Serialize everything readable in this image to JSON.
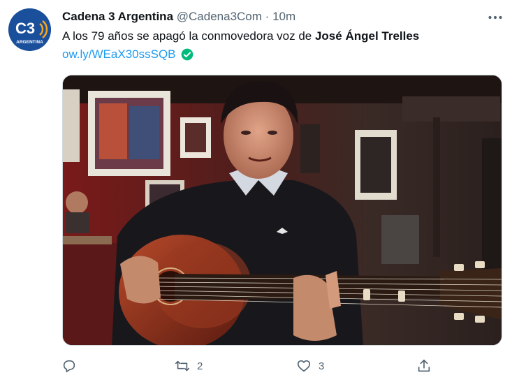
{
  "tweet": {
    "author_name": "Cadena 3 Argentina",
    "handle": "@Cadena3Com",
    "separator": "·",
    "time": "10m",
    "text_prefix": "A los 79 años se apagó la conmovedora voz de ",
    "text_bold": "José Ángel Trelles",
    "link": "ow.ly/WEaX30ssSQB",
    "link_badge_icon": "verified-check-icon",
    "avatar": {
      "logo_text": "C3",
      "logo_subtext": "ARGENTINA",
      "bg_color": "#1a4f9c",
      "accent_color": "#f5a623"
    },
    "media": {
      "description_icon": "photo"
    },
    "actions": {
      "reply": {
        "icon": "reply-icon",
        "count": ""
      },
      "retweet": {
        "icon": "retweet-icon",
        "count": "2"
      },
      "like": {
        "icon": "heart-icon",
        "count": "3"
      },
      "share": {
        "icon": "share-icon",
        "count": ""
      }
    }
  },
  "colors": {
    "link": "#1d9bf0",
    "secondary": "#536471",
    "verified": "#00ba7c"
  }
}
